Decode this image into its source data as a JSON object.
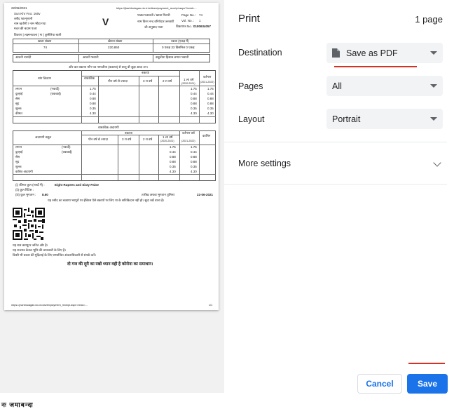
{
  "dialog": {
    "title": "Print",
    "page_count": "1 page",
    "destination_label": "Destination",
    "destination_value": "Save as PDF",
    "pages_label": "Pages",
    "pages_value": "All",
    "layout_label": "Layout",
    "layout_value": "Portrait",
    "more_settings": "More settings",
    "cancel": "Cancel",
    "save": "Save"
  },
  "colors": {
    "accent": "#1a73e8",
    "annotation": "#d93025",
    "select_bg": "#f1f3f4"
  },
  "icons": {
    "destination": "pdf-file-icon",
    "dropdown": "caret-down-icon",
    "expand": "chevron-down-icon"
  },
  "preview": {
    "date": "22/06/2021",
    "header_left_1": "Sun Khr Fno: 160v",
    "header_left_2": "रसीद फाल्गुनानी",
    "header_left_3": "नाम खतौनी / नाम भौंडा गया",
    "header_left_4": "मदन की बदाम पत्‍ता",
    "big_letter": "V",
    "header_mid_1": "पाठ्य पत्रावली / खाता पिटारी",
    "header_mid_2": "नाम विरन नन्द वनियेदार जनवारी",
    "header_mid_3": "जी अनुबाद पाता",
    "page_no_label": "Page No. :",
    "page_no_value": "74",
    "vol_no_label": "Vol. No. :",
    "vol_no_value": "1",
    "receipt_label": "विक्रयपत्र No. :",
    "receipt_value": "0180634057",
    "url_top": "https://jharbhulagan.nic.in/citizen/payment_receipt.aspx?txnid=...",
    "section_line": "विवरण | लक्ष्मनवाला | गा | कुमेलिया बाली",
    "col_a": "खाता संख्या",
    "col_b": "खेसरा संख्या",
    "col_c": "रकबा (एकड़ में)",
    "val_a": "74",
    "val_b": "220,850",
    "val_c": "0 एकड़ 33 डिसमिल 0 एकड़",
    "lower_a": "आवनी नाशंदी",
    "lower_b": "आवनी भवानी",
    "lower_c": "वसूलीता हिसाब लगान भवानी",
    "demand_title": "और कर बकाया माँग पत्र नामजीया (बकाया) से बालू बौ जुड़ा आदा उन।",
    "t1_headers": [
      "मांग विवरण",
      "वास्तविक",
      "बकाया",
      "पौन वर्ष से ज्यादा",
      "3 रा वर्ष",
      "2 रा वर्ष",
      "1 ला वर्ष",
      "(2020-2021)",
      "वर्तमान",
      "(2021-2022)"
    ],
    "t1_rows": [
      {
        "name": "लगान",
        "type": "(नकदी)",
        "a": "1.75",
        "b": "1.75",
        "c": "1.75"
      },
      {
        "name": "दुल्हाई",
        "type": "(वकवाई)",
        "a": "0.44",
        "b": "0.44",
        "c": "0.44"
      },
      {
        "name": "सेस",
        "type": "",
        "a": "0.88",
        "b": "0.88",
        "c": "0.88"
      },
      {
        "name": "सूद",
        "type": "",
        "a": "0.88",
        "b": "0.88",
        "c": "0.88"
      },
      {
        "name": "शुल्क",
        "type": "",
        "a": "0.35",
        "b": "0.35",
        "c": "0.35"
      },
      {
        "name": "कीमत",
        "type": "",
        "a": "4.30",
        "b": "4.30",
        "c": "4.30"
      }
    ],
    "t2_title": "वास्तविक अदायगी",
    "t2_headers": [
      "अदायगी वसूल",
      "बकाया",
      "पौन वर्ष से ज्यादा",
      "3 रा वर्ष",
      "2 रा वर्ष",
      "1 ला वर्ष",
      "(2020-2021)",
      "वर्तमान वर्ष",
      "(2021-2022)",
      "कालिन"
    ],
    "t2_rows": [
      {
        "name": "लगान",
        "type": "(नकदी)",
        "a": "1.75",
        "b": "1.75"
      },
      {
        "name": "दुल्हाई",
        "type": "(वकवाई)",
        "a": "0.44",
        "b": "0.44"
      },
      {
        "name": "सेस",
        "type": "",
        "a": "0.88",
        "b": "0.88"
      },
      {
        "name": "सूद",
        "type": "",
        "a": "0.88",
        "b": "0.88"
      },
      {
        "name": "शुल्क",
        "type": "",
        "a": "0.35",
        "b": "0.35"
      },
      {
        "name": "कलित अदायगी",
        "type": "",
        "a": "4.30",
        "b": "4.30"
      }
    ],
    "amount_words_label": "(i) कीमत कुल (शब्दों में) :",
    "amount_words": "Eight Rupees and Sixty Paise",
    "amount_ii": "(ii) कुल रिटिस :",
    "amount_iii_label": "(iii) कुल भुगतान :",
    "amount_iii_value": "8.60",
    "payment_date_label": "तारीख अथवा भुगतान तुलिनाः",
    "payment_date": "22-06-2021",
    "note_line": "यह रसीद का बकाया भरपूरों पर ईविरस ऐसे बकायों पर लिए या के सतिकिदान नहीं हो। सुदा रखें वाला है।",
    "footnote_1": "यह रास कम्प्यूटर जनित ओर है।",
    "footnote_2": "यह राजपत्र केवल भूमि की जानकारी के लिए है।",
    "footnote_3": "किसी भी प्रकार की मुद्रिताई के लिए सम्बन्धित अंचलाधिकारी से संपर्क करें।",
    "slogan": "दो गज की दूरी का रखो ध्यान वही है कोरोना का समाधान।",
    "url_bottom": "https://jharbhulagan.nic.in/citizen/payment_receipt.aspx?txnid=...",
    "page_mark": "1/1",
    "strip_text": "नः जमाबन्दा"
  }
}
